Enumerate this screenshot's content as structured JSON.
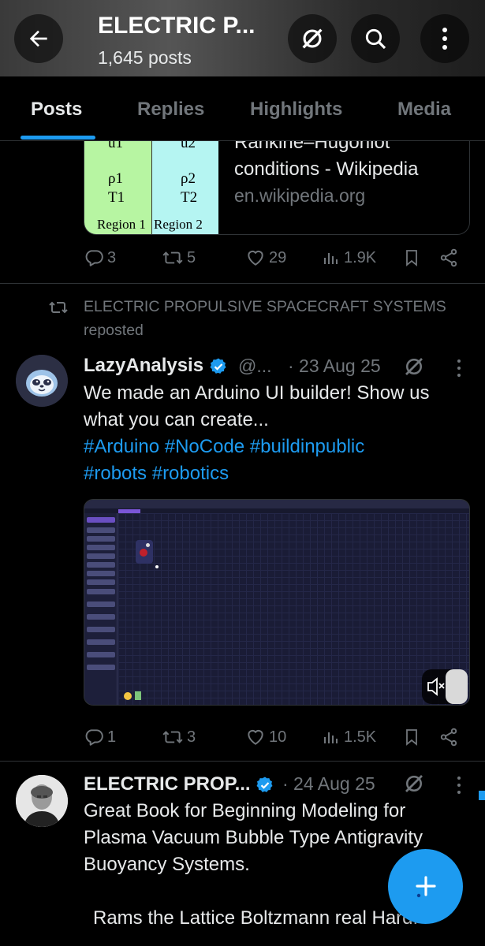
{
  "header": {
    "title": "ELECTRIC P...",
    "post_count": "1,645 posts"
  },
  "tabs": [
    {
      "label": "Posts",
      "active": true
    },
    {
      "label": "Replies",
      "active": false
    },
    {
      "label": "Highlights",
      "active": false
    },
    {
      "label": "Media",
      "active": false
    }
  ],
  "post1": {
    "card": {
      "image_labels": {
        "u1": "u1",
        "u2": "u2",
        "rho1": "ρ1",
        "rho2": "ρ2",
        "t1": "T1",
        "t2": "T2",
        "region1": "Region 1",
        "region2": "Region 2"
      },
      "title_line1": "Rankine–Hugoniot",
      "title_line2": "conditions - Wikipedia",
      "domain": "en.wikipedia.org"
    },
    "actions": {
      "replies": "3",
      "reposts": "5",
      "likes": "29",
      "views": "1.9K"
    }
  },
  "post2": {
    "repost_by": "ELECTRIC PROPULSIVE SPACECRAFT SYSTEMS",
    "repost_label": "reposted",
    "author_name": "LazyAnalysis",
    "handle": "@...",
    "date": "· 23 Aug 25",
    "text_line1": "We made an Arduino UI builder! Show us",
    "text_line2": "what you can create...",
    "hashtags_line1": "#Arduino #NoCode #buildinpublic",
    "hashtags_line2": "#robots #robotics",
    "video": {
      "menu": "File   Edit   Application Secrets   UI Customization   Help",
      "sidebar_items": [
        "Sources",
        "generate",
        "constant",
        "csv file",
        "excel file",
        "database",
        "serial port",
        "note",
        "Syntax",
        "Filter",
        "Compute",
        "Logic",
        "Visual",
        "Firmware",
        "Save"
      ]
    },
    "actions": {
      "replies": "1",
      "reposts": "3",
      "likes": "10",
      "views": "1.5K"
    }
  },
  "post3": {
    "author_name": "ELECTRIC PROP...",
    "date": "· 24 Aug 25",
    "text_line1": "Great Book for Beginning Modeling for",
    "text_line2": "Plasma Vacuum Bubble Type Antigravity",
    "text_line3": "Buoyancy Systems.",
    "text_line4": "Rams the Lattice Boltzmann real Hard."
  },
  "colors": {
    "accent": "#1d9bf0",
    "muted": "#71767b",
    "text": "#e7e9ea",
    "divider": "#2f3336"
  },
  "icons": {
    "back": "arrow-left-icon",
    "grok": "grok-icon",
    "search": "search-icon",
    "more": "more-vertical-icon",
    "reply": "reply-icon",
    "repost": "repost-icon",
    "like": "heart-icon",
    "views": "views-icon",
    "bookmark": "bookmark-icon",
    "share": "share-icon",
    "compose": "plus-icon"
  }
}
